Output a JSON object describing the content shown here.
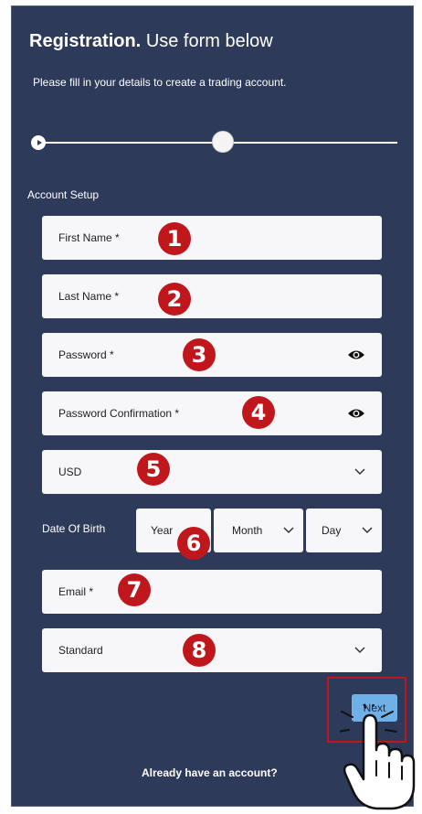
{
  "header": {
    "title_bold": "Registration.",
    "title_rest": "Use form below",
    "subtitle": "Please fill in your details to create a trading account."
  },
  "progress": {
    "current_step": 1,
    "total_steps": 2
  },
  "form": {
    "section_label": "Account Setup",
    "first_name_placeholder": "First Name  *",
    "last_name_placeholder": "Last Name  *",
    "password_placeholder": "Password  *",
    "password_confirm_placeholder": "Password Confirmation  *",
    "currency_value": "USD",
    "dob_label": "Date Of Birth",
    "dob_year": "Year",
    "dob_month": "Month",
    "dob_day": "Day",
    "email_placeholder": "Email  *",
    "account_type_value": "Standard"
  },
  "badges": [
    "1",
    "2",
    "3",
    "4",
    "5",
    "6",
    "7",
    "8"
  ],
  "actions": {
    "next_label": "Next",
    "login_link": "Already have an account?"
  },
  "colors": {
    "panel_bg": "#2e3a5a",
    "field_bg": "#f7f6f8",
    "badge_red": "#c0171c",
    "next_button": "#6fb1e6"
  },
  "icons": {
    "password_toggle": "eye-icon",
    "dropdown": "chevron-down-icon",
    "pointer": "hand-pointer-icon",
    "step_marker": "play-icon"
  }
}
